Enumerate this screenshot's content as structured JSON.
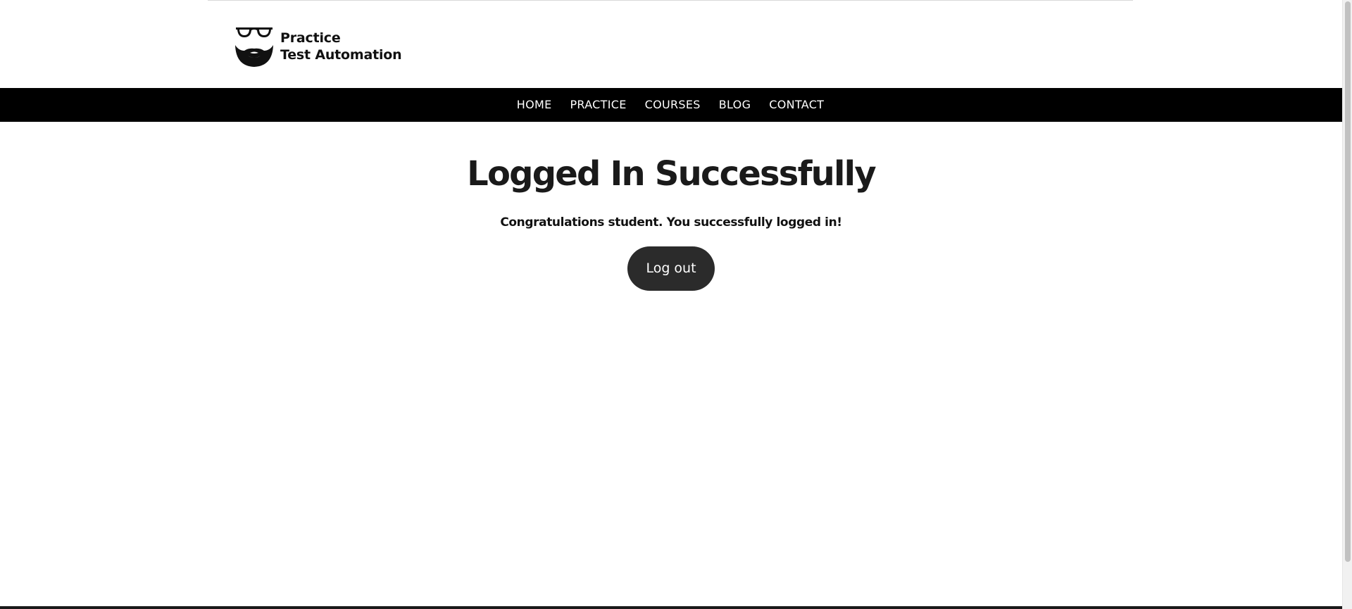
{
  "header": {
    "logo": {
      "line1": "Practice",
      "line2": "Test Automation",
      "icon": "glasses-beard-icon"
    }
  },
  "nav": {
    "items": [
      {
        "label": "HOME"
      },
      {
        "label": "PRACTICE"
      },
      {
        "label": "COURSES"
      },
      {
        "label": "BLOG"
      },
      {
        "label": "CONTACT"
      }
    ]
  },
  "main": {
    "title": "Logged In Successfully",
    "message": "Congratulations student. You successfully logged in!",
    "logout_label": "Log out"
  },
  "colors": {
    "navbar_bg": "#000000",
    "button_bg": "#2b2b2b",
    "text": "#1a1a1a"
  }
}
